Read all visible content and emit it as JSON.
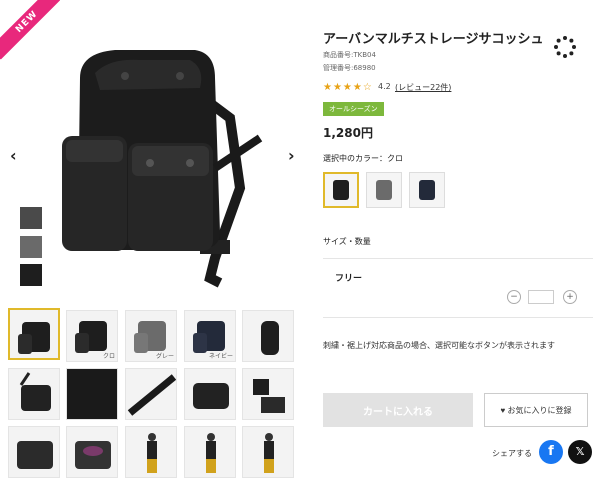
{
  "badge": {
    "new": "NEW"
  },
  "product": {
    "title": "アーバンマルチストレージサコッシュ",
    "item_no": "商品番号:TKB04",
    "manage_no": "管理番号:68980",
    "stars": "★★★★☆",
    "rating": "4.2",
    "review": "(レビュー22件)",
    "season": "オールシーズン",
    "price": "1,280円",
    "color_label": "選択中のカラー：クロ",
    "size_section": "サイズ・数量",
    "size_name": "フリー",
    "qty_value": "",
    "qty_minus": "−",
    "qty_plus": "+",
    "note": "刺繍・裾上げ対応商品の場合、選択可能なボタンが表示されます",
    "cart_label": "カートに入れる",
    "fav_label": "♥ お気に入りに登録",
    "share_label": "シェアする",
    "facebook_glyph": "f",
    "x_glyph": "𝕏"
  },
  "gallery": {
    "prev": "‹",
    "next": "›",
    "thumb_labels": [
      "クロ",
      "グレー",
      "ネイビー"
    ]
  },
  "colors": {
    "selected": "#e0b92a",
    "season": "#7db83c",
    "badge": "#e8287c",
    "facebook": "#1877f2"
  }
}
